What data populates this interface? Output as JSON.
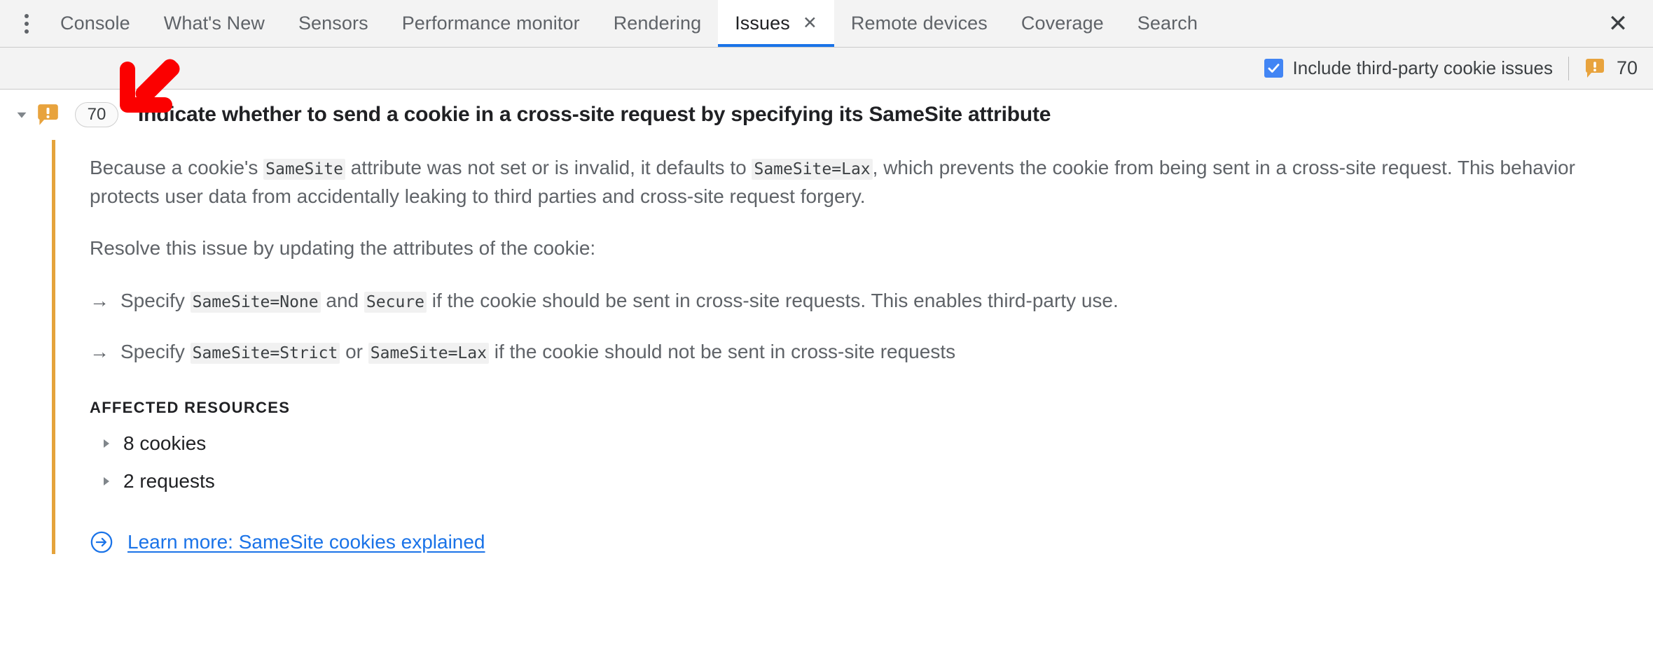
{
  "tabbar": {
    "more_menu_label": "More tools",
    "tabs": [
      {
        "label": "Console",
        "active": false
      },
      {
        "label": "What's New",
        "active": false
      },
      {
        "label": "Sensors",
        "active": false
      },
      {
        "label": "Performance monitor",
        "active": false
      },
      {
        "label": "Rendering",
        "active": false
      },
      {
        "label": "Issues",
        "active": true
      },
      {
        "label": "Remote devices",
        "active": false
      },
      {
        "label": "Coverage",
        "active": false
      },
      {
        "label": "Search",
        "active": false
      }
    ],
    "active_tab_close": "✕",
    "panel_close": "✕"
  },
  "toolbar": {
    "third_party_checkbox_label": "Include third-party cookie issues",
    "third_party_checkbox_checked": true,
    "warning_count": "70",
    "warning_icon": "warning-bubble-icon"
  },
  "issue": {
    "expanded": true,
    "caret_icon": "caret-down-icon",
    "severity_icon": "warning-bubble-icon",
    "count_badge": "70",
    "title": "Indicate whether to send a cookie in a cross-site request by specifying its SameSite attribute",
    "paragraph_1": {
      "part_1": "Because a cookie's ",
      "code_1": "SameSite",
      "part_2": " attribute was not set or is invalid, it defaults to ",
      "code_2": "SameSite=Lax",
      "part_3": ", which prevents the cookie from being sent in a cross-site request. This behavior protects user data from accidentally leaking to third parties and cross-site request forgery."
    },
    "paragraph_2": "Resolve this issue by updating the attributes of the cookie:",
    "fix_marker": "→",
    "fixes": [
      {
        "part_1": "Specify ",
        "code_1": "SameSite=None",
        "part_2": " and ",
        "code_2": "Secure",
        "part_3": " if the cookie should be sent in cross-site requests. This enables third-party use."
      },
      {
        "part_1": "Specify ",
        "code_1": "SameSite=Strict",
        "part_2": " or ",
        "code_2": "SameSite=Lax",
        "part_3": " if the cookie should not be sent in cross-site requests"
      }
    ],
    "affected_resources_title": "Affected resources",
    "resources": [
      {
        "label": "8 cookies",
        "caret_icon": "caret-right-icon"
      },
      {
        "label": "2 requests",
        "caret_icon": "caret-right-icon"
      }
    ],
    "learn_more": {
      "icon": "arrow-in-circle-icon",
      "label": "Learn more: SameSite cookies explained"
    }
  },
  "annotation": {
    "arrow_icon": "red-arrow-down-left-icon",
    "color": "#fb0000"
  },
  "colors": {
    "accent_blue": "#1a73e8",
    "checkbox_blue": "#4285f4",
    "warning_orange": "#e5a33b",
    "text_primary": "#202124",
    "text_secondary": "#5f6368",
    "toolbar_bg": "#f3f3f3"
  }
}
